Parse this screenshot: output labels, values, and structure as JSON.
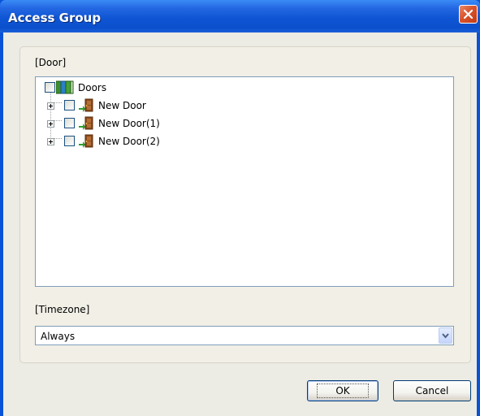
{
  "window": {
    "title": "Access Group",
    "close_icon": "close-icon"
  },
  "door_section": {
    "label": "[Door]",
    "tree": {
      "root": {
        "label": "Doors",
        "checked": false,
        "icon": "door-group-icon"
      },
      "children": [
        {
          "label": "New Door",
          "checked": false,
          "expanded": false,
          "icon": "door-icon"
        },
        {
          "label": "New Door(1)",
          "checked": false,
          "expanded": false,
          "icon": "door-icon"
        },
        {
          "label": "New Door(2)",
          "checked": false,
          "expanded": false,
          "icon": "door-icon"
        }
      ]
    }
  },
  "timezone_section": {
    "label": "[Timezone]",
    "selected": "Always"
  },
  "buttons": {
    "ok": "OK",
    "cancel": "Cancel"
  }
}
